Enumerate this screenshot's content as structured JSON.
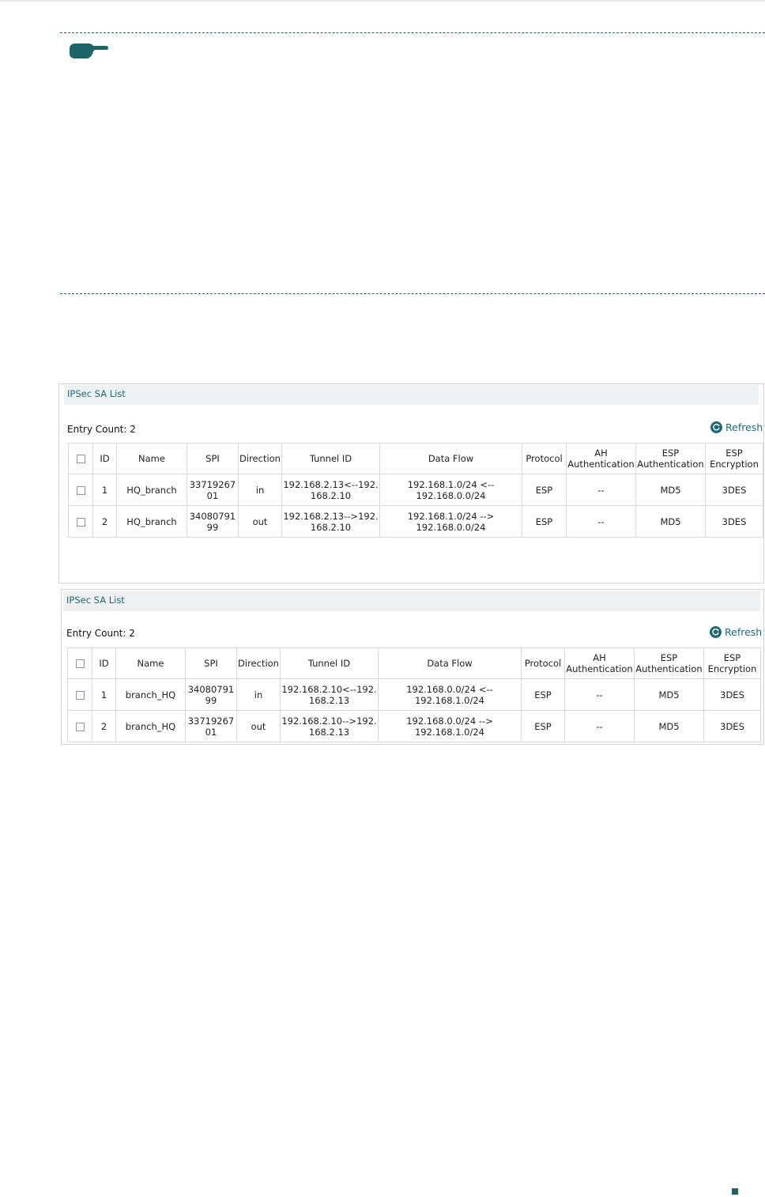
{
  "panels": [
    {
      "title": "IPSec SA List",
      "entry_count": "Entry Count: 2",
      "refresh_label": "Refresh",
      "columns": [
        "ID",
        "Name",
        "SPI",
        "Direction",
        "Tunnel ID",
        "Data Flow",
        "Protocol",
        "AH Authentication",
        "ESP Authentication",
        "ESP Encryption"
      ],
      "rows": [
        {
          "id": "1",
          "name": "HQ_branch",
          "spi": "3371926701",
          "direction": "in",
          "tunnel_id": "192.168.2.13<--192.168.2.10",
          "data_flow": "192.168.1.0/24 <-- 192.168.0.0/24",
          "protocol": "ESP",
          "ah_auth": "--",
          "esp_auth": "MD5",
          "esp_enc": "3DES"
        },
        {
          "id": "2",
          "name": "HQ_branch",
          "spi": "3408079199",
          "direction": "out",
          "tunnel_id": "192.168.2.13-->192.168.2.10",
          "data_flow": "192.168.1.0/24 --> 192.168.0.0/24",
          "protocol": "ESP",
          "ah_auth": "--",
          "esp_auth": "MD5",
          "esp_enc": "3DES"
        }
      ]
    },
    {
      "title": "IPSec SA List",
      "entry_count": "Entry Count: 2",
      "refresh_label": "Refresh",
      "columns": [
        "ID",
        "Name",
        "SPI",
        "Direction",
        "Tunnel ID",
        "Data Flow",
        "Protocol",
        "AH Authentication",
        "ESP Authentication",
        "ESP Encryption"
      ],
      "rows": [
        {
          "id": "1",
          "name": "branch_HQ",
          "spi": "3408079199",
          "direction": "in",
          "tunnel_id": "192.168.2.10<--192.168.2.13",
          "data_flow": "192.168.0.0/24 <-- 192.168.1.0/24",
          "protocol": "ESP",
          "ah_auth": "--",
          "esp_auth": "MD5",
          "esp_enc": "3DES"
        },
        {
          "id": "2",
          "name": "branch_HQ",
          "spi": "3371926701",
          "direction": "out",
          "tunnel_id": "192.168.2.10-->192.168.2.13",
          "data_flow": "192.168.0.0/24 --> 192.168.1.0/24",
          "protocol": "ESP",
          "ah_auth": "--",
          "esp_auth": "MD5",
          "esp_enc": "3DES"
        }
      ]
    }
  ],
  "icons": {
    "note": "pointing-hand-icon",
    "refresh": "refresh-icon"
  },
  "colors": {
    "accent": "#1d6469",
    "title_text": "#1d6a74",
    "title_bar": "#eef0f1",
    "border": "#d7dadd"
  }
}
